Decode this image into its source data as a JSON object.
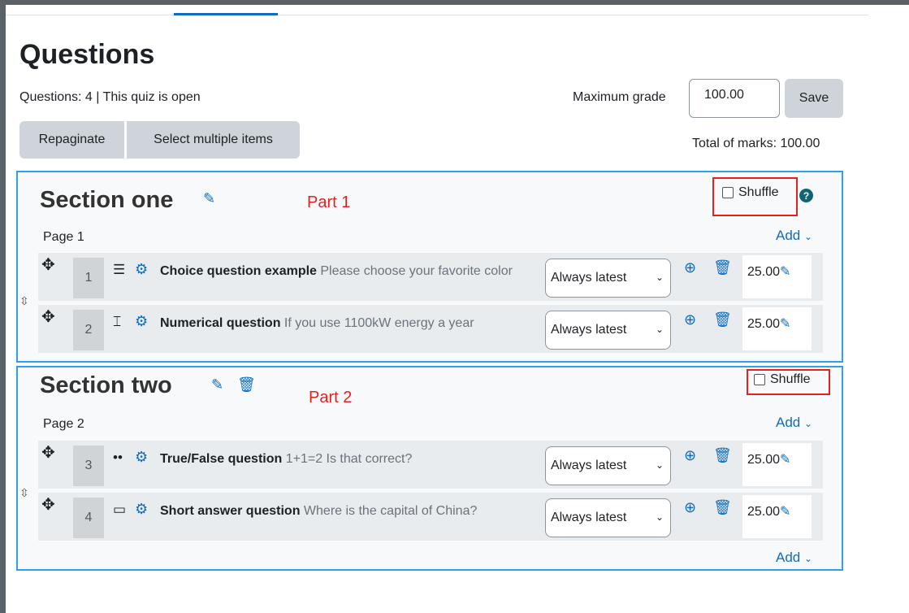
{
  "header": {
    "title": "Questions",
    "info": "Questions: 4 | This quiz is open",
    "max_grade_label": "Maximum grade",
    "max_grade_value": "100.00",
    "save_label": "Save",
    "repaginate_label": "Repaginate",
    "select_multiple_label": "Select multiple items",
    "total_marks": "Total of marks: 100.00"
  },
  "sections": [
    {
      "title": "Section one",
      "annotation": "Part 1",
      "shuffle_label": "Shuffle",
      "page_label": "Page 1",
      "add_label": "Add",
      "questions": [
        {
          "number": "1",
          "type_icon": "multichoice-icon",
          "name": "Choice question example",
          "text": " Please choose your favorite color",
          "version": "Always latest",
          "mark": "25.00"
        },
        {
          "number": "2",
          "type_icon": "numerical-icon",
          "name": "Numerical question",
          "text": " If you use 1100kW energy a year",
          "version": "Always latest",
          "mark": "25.00"
        }
      ]
    },
    {
      "title": "Section two",
      "annotation": "Part 2",
      "shuffle_label": "Shuffle",
      "page_label": "Page 2",
      "add_label": "Add",
      "questions": [
        {
          "number": "3",
          "type_icon": "truefalse-icon",
          "name": "True/False question",
          "text": " 1+1=2 Is that correct?",
          "version": "Always latest",
          "mark": "25.00"
        },
        {
          "number": "4",
          "type_icon": "shortanswer-icon",
          "name": "Short answer question",
          "text": " Where is the capital of China?",
          "version": "Always latest",
          "mark": "25.00"
        }
      ]
    }
  ],
  "colors": {
    "accent": "#0f6cbf",
    "section_border": "#2ea1e8",
    "annotation_red": "#e81f1f",
    "button_bg": "#ced4da"
  }
}
